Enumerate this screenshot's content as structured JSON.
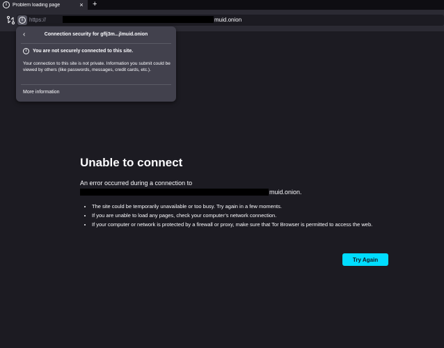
{
  "tab": {
    "title": "Problem loading page",
    "close_glyph": "×",
    "new_tab_glyph": "+"
  },
  "urlbar": {
    "scheme": "https://",
    "host_suffix": "muid.onion"
  },
  "security_panel": {
    "back_glyph": "‹",
    "title": "Connection security for gflj3m...jlmuid.onion",
    "warning": "You are not securely connected to this site.",
    "description": "Your connection to this site is not private. Information you submit could be viewed by others (like passwords, messages, credit cards, etc.).",
    "more_info": "More information"
  },
  "error": {
    "title": "Unable to connect",
    "line1": "An error occurred during a connection to",
    "host_suffix": "muid.onion.",
    "bullets": [
      "The site could be temporarily unavailable or too busy. Try again in a few moments.",
      "If you are unable to load any pages, check your computer’s network connection.",
      "If your computer or network is protected by a firewall or proxy, make sure that Tor Browser is permitted to access the web."
    ],
    "try_again": "Try Again"
  },
  "icons": {
    "info": "info-icon",
    "tor": "tor-circuit-icon",
    "back": "chevron-left-icon",
    "close": "close-icon",
    "plus": "plus-icon"
  },
  "colors": {
    "background": "#1c1b22",
    "panel": "#42414d",
    "accent": "#00ddff"
  }
}
